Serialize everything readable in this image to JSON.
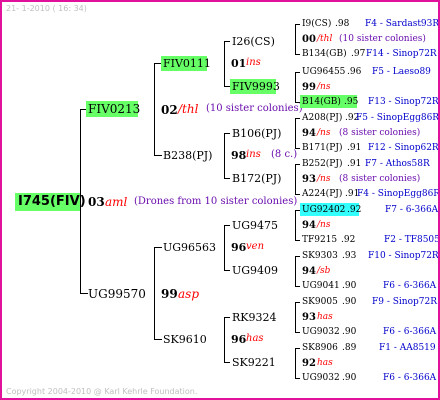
{
  "header": {
    "date": "21- 1-2010 ( 16: 34)"
  },
  "footer": {
    "copyright": "Copyright 2004-2010 @ Karl Kehrle Foundation."
  },
  "colors": {
    "border": "#e0119a",
    "highlight_green": "#66ff66",
    "highlight_cyan": "#33ffff",
    "mark_red": "#ff0000",
    "ref_blue": "#0000cc",
    "note_purple": "#6a0dad"
  },
  "root": {
    "name": "I745(FIV)",
    "gen": "03",
    "code": "aml",
    "note": "(Drones from 10 sister colonies)"
  },
  "level1": {
    "top": {
      "name": "FIV0213",
      "gen": "02",
      "code": "/thl",
      "note": "(10 sister colonies)"
    },
    "bottom": {
      "name": "UG99570",
      "gen": "99",
      "code": "asp"
    }
  },
  "level2": {
    "fiv0111": {
      "name": "FIV0111",
      "gen": "01",
      "code": "ins"
    },
    "b238": {
      "name": "B238(PJ)",
      "gen": "98",
      "code": "ins",
      "note": "(8 c.)"
    },
    "ug96563": {
      "name": "UG96563",
      "gen": "96",
      "code": "ven"
    },
    "sk9610": {
      "name": "SK9610",
      "gen": "96",
      "code": "has"
    }
  },
  "level3": {
    "i26": "I26(CS)",
    "fiv9993": "FIV9993",
    "b106": "B106(PJ)",
    "b172": "B172(PJ)",
    "ug9475": "UG9475",
    "ug9409": "UG9409",
    "rk9324": "RK9324",
    "sk9221": "SK9221"
  },
  "level4": [
    {
      "name": "I9(CS)",
      "val": ".98",
      "ref": "F4 - Sardast93R"
    },
    {
      "gen": "00",
      "code": "/thl",
      "note": "(10 sister colonies)"
    },
    {
      "name": "B134(GB)",
      "val": ".97",
      "ref": "F14 - Sinop72R"
    },
    {
      "name": "UG96455",
      "val": ".96",
      "ref": "F5 - Laeso89"
    },
    {
      "gen": "99",
      "code": "/ns"
    },
    {
      "name": "B14(GB)",
      "val": ".95",
      "ref": "F13 - Sinop72R"
    },
    {
      "name": "A208(PJ)",
      "val": ".92",
      "ref": "F5 - SinopEgg86R"
    },
    {
      "gen": "94",
      "code": "/ns",
      "note": "(8 sister colonies)"
    },
    {
      "name": "B171(PJ)",
      "val": ".91",
      "ref": "F12 - Sinop62R"
    },
    {
      "name": "B252(PJ)",
      "val": ".91",
      "ref": "F7 - Athos58R"
    },
    {
      "gen": "93",
      "code": "/ns",
      "note": "(8 sister colonies)"
    },
    {
      "name": "A224(PJ)",
      "val": ".91",
      "ref": "F4 - SinopEgg86R"
    },
    {
      "name": "UG92402",
      "val": ".92",
      "ref": "F7 - 6-366A"
    },
    {
      "gen": "94",
      "code": "/ns"
    },
    {
      "name": "TF9215",
      "val": ".92",
      "ref": "F2 - TF8505"
    },
    {
      "name": "SK9303",
      "val": ".93",
      "ref": "F10 - Sinop72R"
    },
    {
      "gen": "94",
      "code": "/sb"
    },
    {
      "name": "UG9041",
      "val": ".90",
      "ref": "F6 - 6-366A"
    },
    {
      "name": "SK9005",
      "val": ".90",
      "ref": "F9 - Sinop72R"
    },
    {
      "gen": "93",
      "code": "has"
    },
    {
      "name": "UG9032",
      "val": ".90",
      "ref": "F6 - 6-366A"
    },
    {
      "name": "SK8906",
      "val": ".89",
      "ref": "F1 - AA8519"
    },
    {
      "gen": "92",
      "code": "has"
    },
    {
      "name": "UG9032",
      "val": ".90",
      "ref": "F6 - 6-366A"
    }
  ]
}
